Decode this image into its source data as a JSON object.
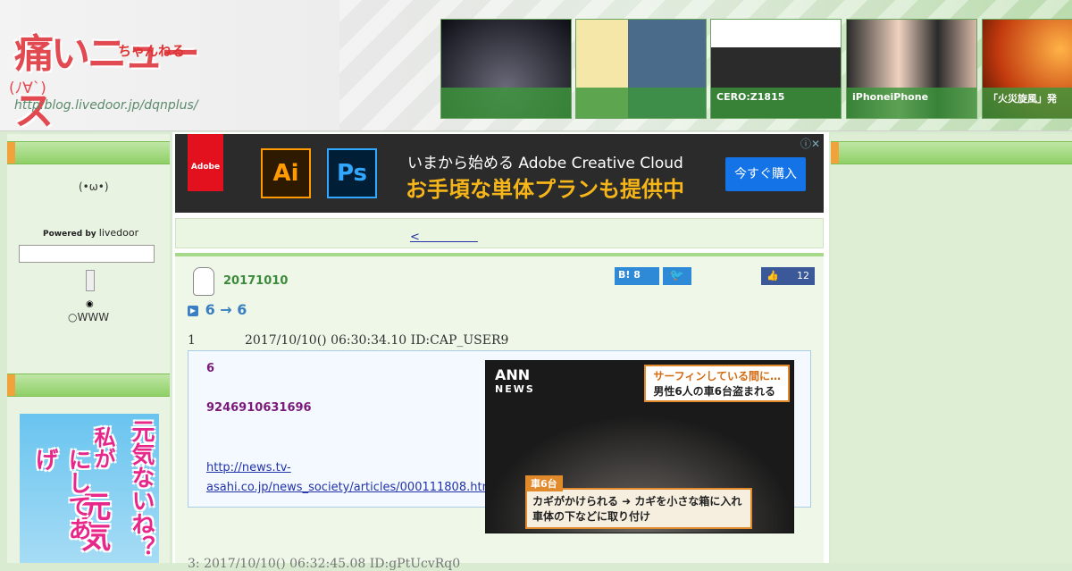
{
  "header": {
    "logo_main": "痛いニュース",
    "logo_ruby": "ちゃんねる",
    "logo_face": "(ﾉ∀`)",
    "logo_url": "http:blog.livedoor.jp/dqnplus/"
  },
  "thumbs": [
    {
      "caption": ""
    },
    {
      "caption": ""
    },
    {
      "caption": "CERO:Z1815"
    },
    {
      "caption": "iPhoneiPhone"
    },
    {
      "caption": "「火災旋風」発"
    }
  ],
  "ad": {
    "brand": "Adobe",
    "icon_ai": "Ai",
    "icon_ps": "Ps",
    "line1": "いまから始める Adobe Creative Cloud",
    "line2": "お手頃な単体プランも提供中",
    "button": "今すぐ購入",
    "info": "ⓘ✕"
  },
  "sidebar": {
    "powered_label": "Powered by",
    "powered_brand": "livedoor",
    "radio_www": "WWW"
  },
  "nav": {
    "prev_link": "<　　　　　"
  },
  "article": {
    "date": "20171010",
    "hatena_label": "B!",
    "hatena_count": "8",
    "twitter_label": "🐦",
    "fb_count": "12",
    "title": "6 → 6",
    "res1_num": "1",
    "res1_meta": "2017/10/10() 06:30:34.10 ID:CAP_USER9",
    "res1_text1": "6",
    "res1_text2": "9246910631696",
    "res1_link": "http://news.tv-asahi.co.jp/news_society/articles/000111808.html",
    "news_logo": "ANN",
    "news_logo_sub": "NEWS",
    "news_caption_top1": "サーフィンしている間に…",
    "news_caption_top2": "男性6人の車6台盗まれる",
    "news_tag": "車6台",
    "news_caption_bottom": "カギがかけられる ➜ カギを小さな箱に入れ車体の下などに取り付け",
    "res2_meta": "3:  2017/10/10() 06:32:45.08 ID:gPtUcvRq0"
  },
  "banner": {
    "line1": "元気ないね？",
    "line2": "私が",
    "line3": "元気",
    "line4": "にしてあげ"
  }
}
